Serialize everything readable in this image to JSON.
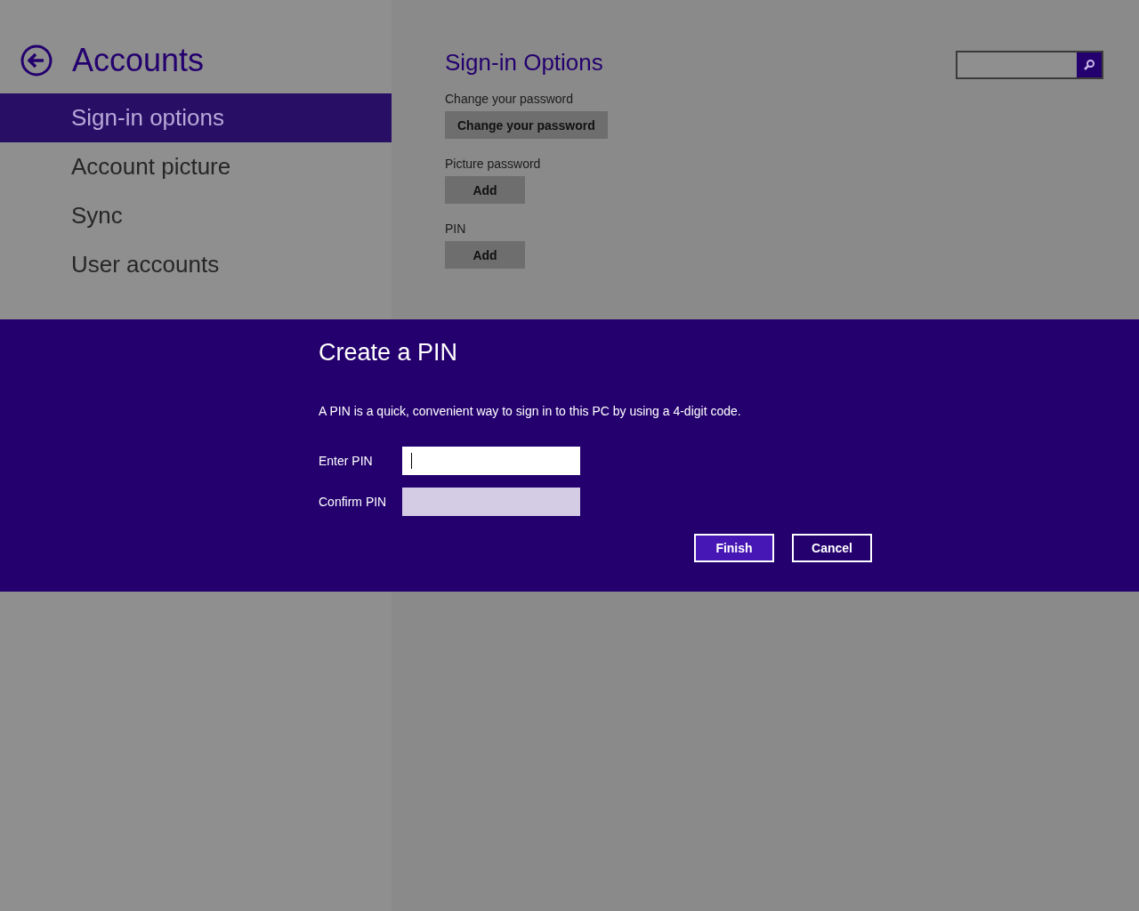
{
  "header": {
    "title": "Accounts"
  },
  "sidebar": {
    "items": [
      {
        "label": "Sign-in options",
        "selected": true
      },
      {
        "label": "Account picture",
        "selected": false
      },
      {
        "label": "Sync",
        "selected": false
      },
      {
        "label": "User accounts",
        "selected": false
      }
    ]
  },
  "content": {
    "title": "Sign-in Options",
    "sections": [
      {
        "label": "Change your password",
        "button": "Change your password"
      },
      {
        "label": "Picture password",
        "button": "Add"
      },
      {
        "label": "PIN",
        "button": "Add"
      }
    ]
  },
  "dialog": {
    "title": "Create a PIN",
    "description": "A PIN is a quick, convenient way to sign in to this PC by using a 4-digit code.",
    "fields": [
      {
        "label": "Enter PIN",
        "focused": true,
        "disabled": false
      },
      {
        "label": "Confirm PIN",
        "focused": false,
        "disabled": true
      }
    ],
    "buttons": [
      {
        "label": "Finish",
        "kind": "primary"
      },
      {
        "label": "Cancel",
        "kind": "secondary"
      }
    ]
  }
}
